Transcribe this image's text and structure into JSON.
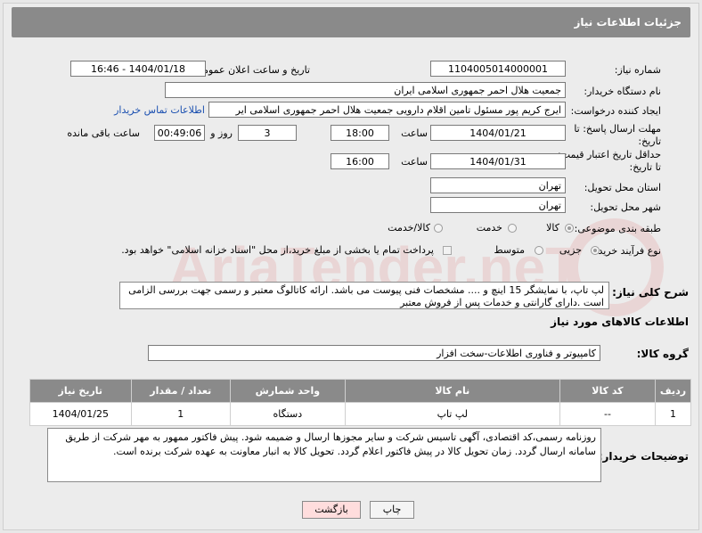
{
  "header": {
    "title": "جزئیات اطلاعات نیاز"
  },
  "watermark": {
    "text": "AriaTender.neT"
  },
  "fields": {
    "need_number_label": "شماره نیاز:",
    "need_number_value": "1104005014000001",
    "announce_label": "تاریخ و ساعت اعلان عمومی:",
    "announce_value": "1404/01/18 - 16:46",
    "buyer_org_label": "نام دستگاه خریدار:",
    "buyer_org_value": "جمعیت هلال احمر جمهوری اسلامی ایران",
    "creator_label": "ایجاد کننده درخواست:",
    "creator_value": "ایرج کریم پور مسئول تامین اقلام دارویی جمعیت هلال احمر جمهوری اسلامی ایر",
    "contact_link": "اطلاعات تماس خریدار",
    "reply_deadline_label_line1": "مهلت ارسال پاسخ: تا",
    "reply_deadline_label_line2": "تاریخ:",
    "reply_date": "1404/01/21",
    "time_label": "ساعت",
    "reply_time": "18:00",
    "days_value": "3",
    "days_label": "روز و",
    "remaining_value": "00:49:06",
    "remaining_label": "ساعت باقی مانده",
    "price_deadline_label_line1": "حداقل تاریخ اعتبار قیمت:",
    "price_deadline_label_line2": "تا تاریخ:",
    "price_date": "1404/01/31",
    "price_time": "16:00",
    "province_label": "استان محل تحویل:",
    "province_value": "تهران",
    "city_label": "شهر محل تحویل:",
    "city_value": "تهران",
    "category_label": "طبقه بندی موضوعی:",
    "category_options": [
      "کالا",
      "خدمت",
      "کالا/خدمت"
    ],
    "process_label": "نوع فرآیند خرید :",
    "process_options": [
      "جزیی",
      "متوسط"
    ],
    "payment_text": "پرداخت تمام یا بخشی از مبلغ خرید،از محل \"اسناد خزانه اسلامی\" خواهد بود."
  },
  "description": {
    "label": "شرح کلی نیاز:",
    "text": "لپ تاپ، با نمایشگر 15 اینچ و .... مشخصات فنی پیوست می باشد. ارائه کاتالوگ معتبر و رسمی جهت بررسی الزامی است .دارای گارانتی و خدمات پس از فروش معتبر"
  },
  "goods_info_title": "اطلاعات کالاهای مورد نیاز",
  "goods_group": {
    "label": "گروه کالا:",
    "value": "کامپیوتر و فناوری اطلاعات-سخت افزار"
  },
  "table": {
    "headers": [
      "ردیف",
      "کد کالا",
      "نام کالا",
      "واحد شمارش",
      "تعداد / مقدار",
      "تاریخ نیاز"
    ],
    "rows": [
      [
        "1",
        "--",
        "لپ تاپ",
        "دستگاه",
        "1",
        "1404/01/25"
      ]
    ]
  },
  "buyer_notes": {
    "label": "توضیحات خریدار:",
    "text": "روزنامه رسمی،کد اقتصادی، آگهی تاسیس شرکت و سایر مجوزها ارسال و ضمیمه شود. پیش فاکتور ممهور به مهر شرکت از طریق سامانه ارسال گردد. زمان تحویل کالا در پیش فاکتور اعلام گردد. تحویل کالا به انبار معاونت به عهده شرکت برنده است."
  },
  "buttons": {
    "print": "چاپ",
    "back": "بازگشت"
  }
}
